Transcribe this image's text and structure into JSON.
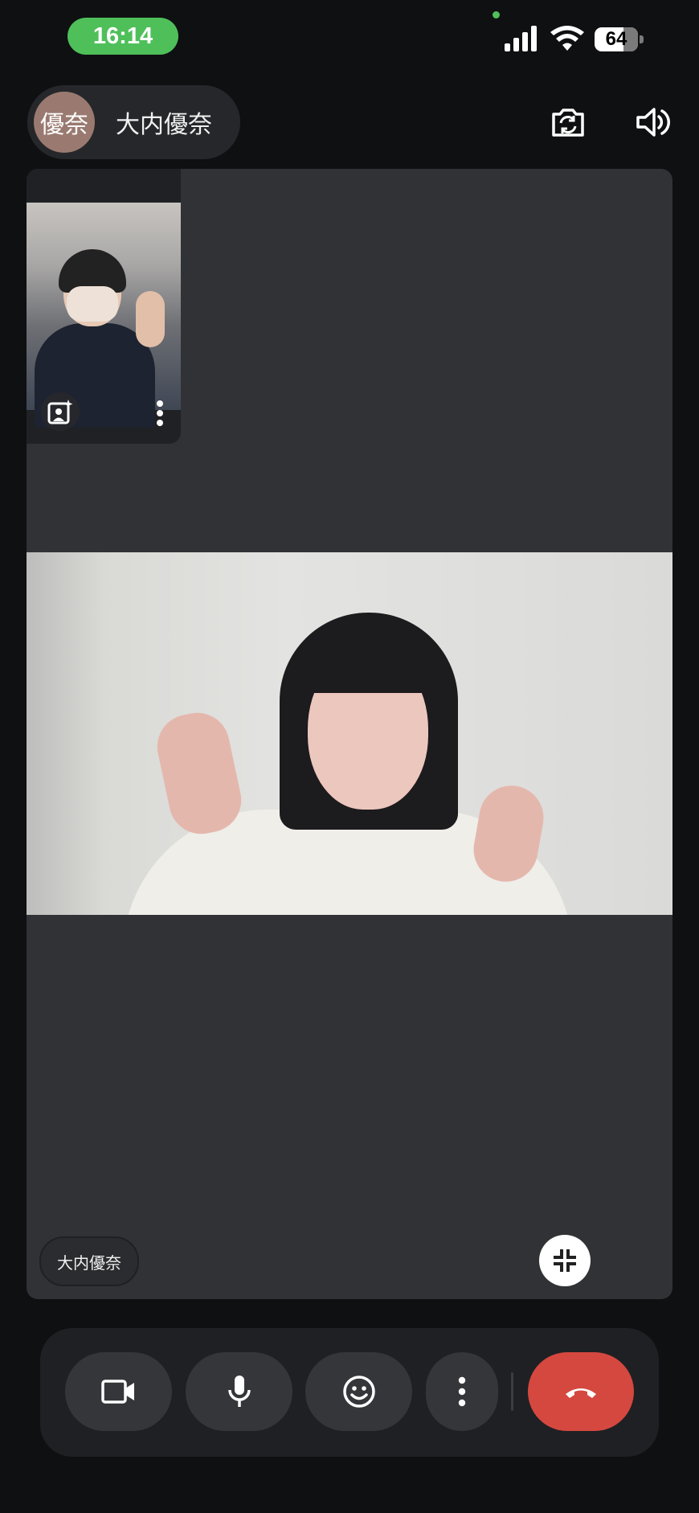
{
  "status_bar": {
    "time": "16:14",
    "battery_level": "64",
    "colors": {
      "time_pill": "#4fbf5a"
    }
  },
  "header": {
    "avatar_text": "優奈",
    "contact_name": "大内優奈",
    "icons": [
      "camera-flip-icon",
      "speaker-icon"
    ]
  },
  "stage": {
    "self_view": {
      "icons": [
        "add-effects-icon",
        "more-vert-icon"
      ]
    },
    "remote_name_chip": "大内優奈",
    "minimize_icon": "minimize-icon"
  },
  "controls": {
    "icons": [
      "video-camera-icon",
      "microphone-icon",
      "emoji-icon",
      "more-vert-icon",
      "end-call-icon"
    ],
    "colors": {
      "end_call": "#d5483f",
      "button_bg": "#35363a"
    }
  }
}
